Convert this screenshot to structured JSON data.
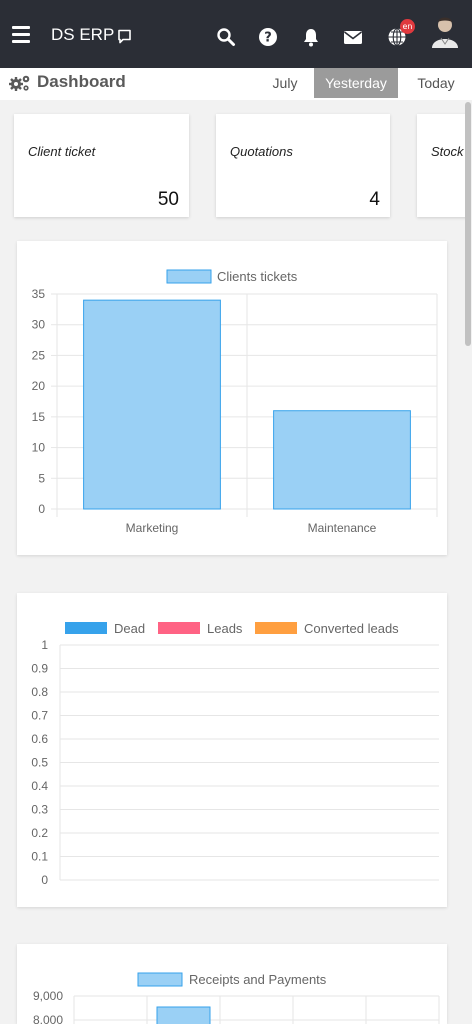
{
  "topbar": {
    "brand": "DS ERP",
    "language_badge": "en",
    "colors": {
      "background": "#2b2e36",
      "badge": "#e0393e"
    },
    "icons": [
      "menu-icon",
      "chat-icon",
      "search-icon",
      "help-icon",
      "bell-icon",
      "mail-icon",
      "globe-icon",
      "avatar"
    ]
  },
  "subbar": {
    "title": "Dashboard",
    "periods": [
      "July",
      "Yesterday",
      "Today"
    ],
    "active_period": "Yesterday"
  },
  "kpis": [
    {
      "label": "Client ticket",
      "value": "50"
    },
    {
      "label": "Quotations",
      "value": "4"
    },
    {
      "label": "Stock",
      "value": ""
    }
  ],
  "chart_data": [
    {
      "type": "bar",
      "categories": [
        "Marketing",
        "Maintenance"
      ],
      "series": [
        {
          "name": "Clients tickets",
          "values": [
            34,
            16
          ]
        }
      ],
      "yticks": [
        "0",
        "5",
        "10",
        "15",
        "20",
        "25",
        "30",
        "35"
      ],
      "ylim": [
        0,
        35
      ],
      "grid": true,
      "legend": "top",
      "colors": {
        "fill": "#9ad0f5",
        "stroke": "#36a2eb"
      }
    },
    {
      "type": "line",
      "categories": [],
      "series": [
        {
          "name": "Dead",
          "values": [],
          "color": "#36a2eb"
        },
        {
          "name": "Leads",
          "values": [],
          "color": "#ff6384"
        },
        {
          "name": "Converted leads",
          "values": [],
          "color": "#ff9f40"
        }
      ],
      "yticks": [
        "0",
        "0.1",
        "0.2",
        "0.3",
        "0.4",
        "0.5",
        "0.6",
        "0.7",
        "0.8",
        "0.9",
        "1"
      ],
      "ylim": [
        0,
        1
      ],
      "grid": true,
      "legend": "top"
    },
    {
      "type": "bar",
      "categories": [],
      "series": [
        {
          "name": "Receipts and Payments",
          "values": []
        }
      ],
      "yticks": [
        "8,000",
        "9,000"
      ],
      "grid": true,
      "legend": "top",
      "colors": {
        "fill": "#9ad0f5",
        "stroke": "#36a2eb"
      }
    }
  ]
}
